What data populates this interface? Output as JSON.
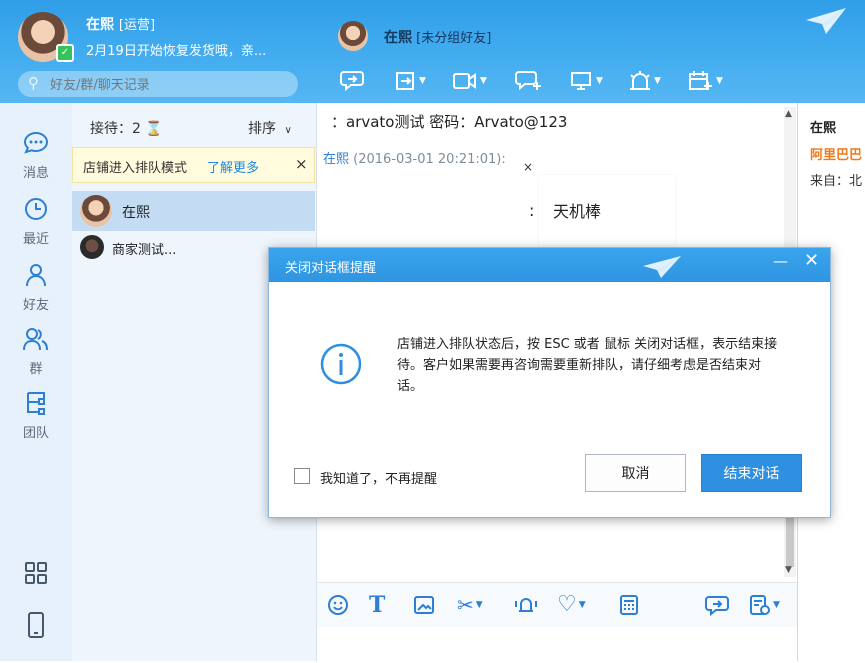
{
  "user": {
    "name": "在熙",
    "tag": "[运营]",
    "status_text": "2月19日开始恢复发货哦，亲..."
  },
  "search": {
    "placeholder": "好友/群/聊天记录"
  },
  "contact": {
    "name": "在熙",
    "group": "[未分组好友]"
  },
  "header_toolbar": [
    "chat-bubble-icon",
    "transfer-icon",
    "video-icon",
    "add-chat-icon",
    "screen-share-icon",
    "alarm-icon",
    "calendar-add-icon"
  ],
  "sidebar": {
    "items": [
      {
        "label": "消息",
        "icon": "message-icon"
      },
      {
        "label": "最近",
        "icon": "clock-icon"
      },
      {
        "label": "好友",
        "icon": "person-icon"
      },
      {
        "label": "群",
        "icon": "group-icon"
      },
      {
        "label": "团队",
        "icon": "team-icon"
      }
    ]
  },
  "sessions": {
    "reception_label": "接待：2",
    "sort_label": "排序",
    "notice_text": "店铺进入排队模式",
    "notice_link": "了解更多",
    "items": [
      {
        "name": "在熙"
      },
      {
        "name": "商家测试..."
      }
    ]
  },
  "chat": {
    "line1": "：arvato测试 密码：Arvato@123",
    "sender": "在熙",
    "timestamp": "(2016-03-01 20:21:01):",
    "bubble": "天机棒",
    "close_x": "×"
  },
  "chat_toolbar": [
    "emoji-icon",
    "font-icon",
    "image-icon",
    "scissors-icon",
    "shake-icon",
    "heart-icon",
    "calculator-icon",
    "quick-reply-icon",
    "more-icon"
  ],
  "info_panel": {
    "name": "在熙",
    "company": "阿里巴巴",
    "from": "来自：北"
  },
  "dialog": {
    "title": "关闭对话框提醒",
    "message": "店铺进入排队状态后，按 ESC 或者 鼠标 关闭对话框，表示结束接待。客户如果需要再咨询需要重新排队，请仔细考虑是否结束对话。",
    "checkbox_label": "我知道了，不再提醒",
    "cancel_label": "取消",
    "confirm_label": "结束对话"
  },
  "colors": {
    "header_blue": "#3aa6ee",
    "accent": "#2f8fe0",
    "link": "#1e88e5",
    "company_orange": "#f07a17"
  }
}
